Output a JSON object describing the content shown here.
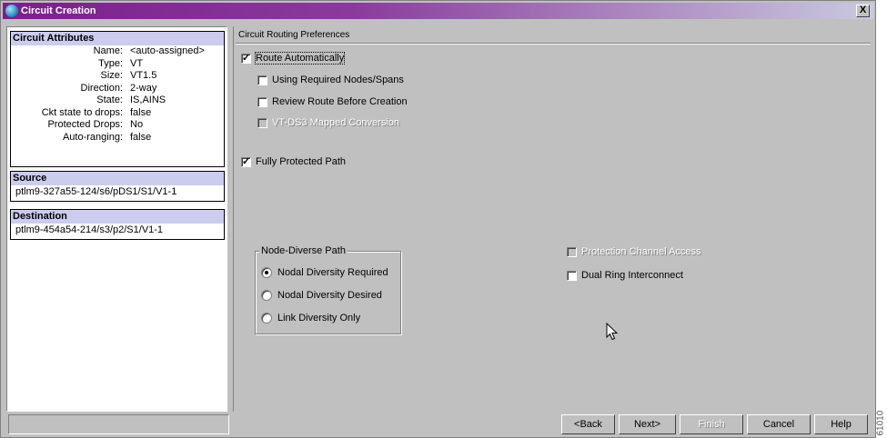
{
  "window": {
    "title": "Circuit Creation",
    "close_label": "X"
  },
  "summary": {
    "attributes_header": "Circuit Attributes",
    "attributes": [
      {
        "label": "Name:",
        "value": "<auto-assigned>"
      },
      {
        "label": "Type:",
        "value": "VT"
      },
      {
        "label": "Size:",
        "value": "VT1.5"
      },
      {
        "label": "Direction:",
        "value": "2-way"
      },
      {
        "label": "State:",
        "value": "IS,AINS"
      },
      {
        "label": "Ckt state to drops:",
        "value": "false"
      },
      {
        "label": "Protected Drops:",
        "value": "No"
      },
      {
        "label": "Auto-ranging:",
        "value": "false"
      }
    ],
    "source_header": "Source",
    "source_value": "ptlm9-327a55-124/s6/pDS1/S1/V1-1",
    "destination_header": "Destination",
    "destination_value": "ptlm9-454a54-214/s3/p2/S1/V1-1"
  },
  "routing": {
    "section_title": "Circuit Routing Preferences",
    "route_automatically": {
      "label": "Route Automatically",
      "checked": true
    },
    "using_required_nodes": {
      "label": "Using Required Nodes/Spans",
      "checked": false
    },
    "review_route": {
      "label": "Review Route Before Creation",
      "checked": false
    },
    "vt_ds3": {
      "label": "VT-DS3 Mapped Conversion",
      "checked": false,
      "enabled": false
    },
    "fully_protected": {
      "label": "Fully Protected Path",
      "checked": true
    },
    "node_diverse_group": "Node-Diverse Path",
    "diversity_options": [
      {
        "label": "Nodal Diversity Required",
        "selected": true
      },
      {
        "label": "Nodal Diversity Desired",
        "selected": false
      },
      {
        "label": "Link Diversity Only",
        "selected": false
      }
    ],
    "protection_channel": {
      "label": "Protection Channel Access",
      "checked": false,
      "enabled": false
    },
    "dual_ring": {
      "label": "Dual Ring Interconnect",
      "checked": false
    }
  },
  "buttons": {
    "back": "<Back",
    "next": "Next>",
    "finish": "Finish",
    "cancel": "Cancel",
    "help": "Help"
  },
  "watermark": "61010"
}
